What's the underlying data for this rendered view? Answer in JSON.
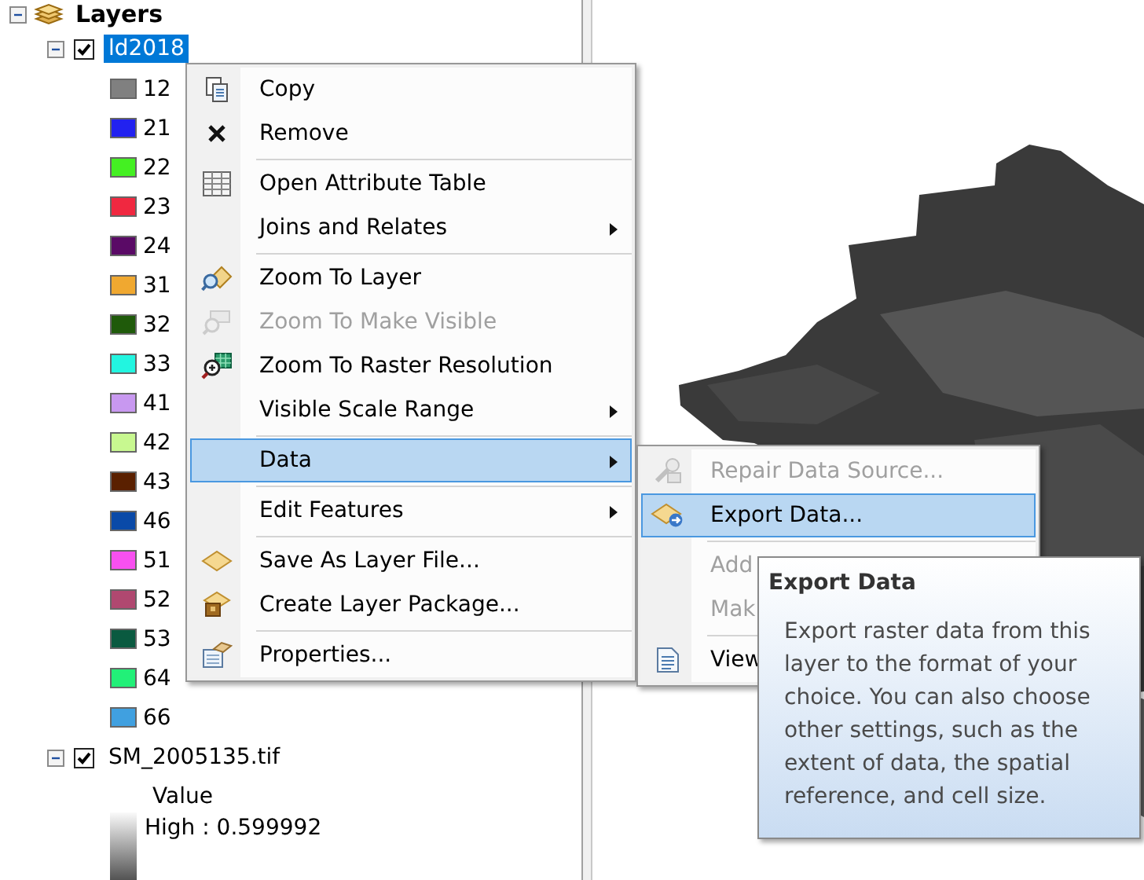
{
  "toc": {
    "title": "Layers",
    "expanded": true,
    "layers": [
      {
        "name": "ld2018",
        "expanded": true,
        "checked": true,
        "selected": true,
        "legend": [
          {
            "label": "12",
            "color": "#808080"
          },
          {
            "label": "21",
            "color": "#2222f0"
          },
          {
            "label": "22",
            "color": "#44f022"
          },
          {
            "label": "23",
            "color": "#f02840"
          },
          {
            "label": "24",
            "color": "#5a0a66"
          },
          {
            "label": "31",
            "color": "#f0a830"
          },
          {
            "label": "32",
            "color": "#1f5a0a"
          },
          {
            "label": "33",
            "color": "#22f5e0"
          },
          {
            "label": "41",
            "color": "#c898f0"
          },
          {
            "label": "42",
            "color": "#c8f890"
          },
          {
            "label": "43",
            "color": "#5a2000"
          },
          {
            "label": "46",
            "color": "#0a4aa8"
          },
          {
            "label": "51",
            "color": "#f850f0"
          },
          {
            "label": "52",
            "color": "#b04870"
          },
          {
            "label": "53",
            "color": "#0a5a40"
          },
          {
            "label": "64",
            "color": "#22f078"
          },
          {
            "label": "66",
            "color": "#40a0e0"
          }
        ]
      },
      {
        "name": "SM_2005135.tif",
        "expanded": true,
        "checked": true,
        "selected": false,
        "field": "Value",
        "high": "High : 0.599992"
      }
    ]
  },
  "context_menu": {
    "items": [
      {
        "kind": "item",
        "label": "Copy",
        "disabled": false,
        "selected": false,
        "submenu": false
      },
      {
        "kind": "item",
        "label": "Remove",
        "disabled": false,
        "selected": false,
        "submenu": false
      },
      {
        "kind": "separator"
      },
      {
        "kind": "item",
        "label": "Open Attribute Table",
        "disabled": false,
        "selected": false,
        "submenu": false
      },
      {
        "kind": "item",
        "label": "Joins and Relates",
        "disabled": false,
        "selected": false,
        "submenu": true
      },
      {
        "kind": "separator"
      },
      {
        "kind": "item",
        "label": "Zoom To Layer",
        "disabled": false,
        "selected": false,
        "submenu": false
      },
      {
        "kind": "item",
        "label": "Zoom To Make Visible",
        "disabled": true,
        "selected": false,
        "submenu": false
      },
      {
        "kind": "item",
        "label": "Zoom To Raster Resolution",
        "disabled": false,
        "selected": false,
        "submenu": false
      },
      {
        "kind": "item",
        "label": "Visible Scale Range",
        "disabled": false,
        "selected": false,
        "submenu": true
      },
      {
        "kind": "separator"
      },
      {
        "kind": "item",
        "label": "Data",
        "disabled": false,
        "selected": true,
        "submenu": true
      },
      {
        "kind": "separator"
      },
      {
        "kind": "item",
        "label": "Edit Features",
        "disabled": false,
        "selected": false,
        "submenu": true
      },
      {
        "kind": "separator"
      },
      {
        "kind": "item",
        "label": "Save As Layer File...",
        "disabled": false,
        "selected": false,
        "submenu": false
      },
      {
        "kind": "item",
        "label": "Create Layer Package...",
        "disabled": false,
        "selected": false,
        "submenu": false
      },
      {
        "kind": "separator"
      },
      {
        "kind": "item",
        "label": "Properties...",
        "disabled": false,
        "selected": false,
        "submenu": false
      }
    ]
  },
  "submenu": {
    "items": [
      {
        "kind": "item",
        "label": "Repair Data Source...",
        "disabled": true,
        "selected": false,
        "submenu": false
      },
      {
        "kind": "item",
        "label": "Export Data...",
        "disabled": false,
        "selected": true,
        "submenu": false
      },
      {
        "kind": "separator"
      },
      {
        "kind": "item",
        "label": "Add",
        "disabled": true,
        "selected": false,
        "submenu": false
      },
      {
        "kind": "item",
        "label": "Mak",
        "disabled": true,
        "selected": false,
        "submenu": false
      },
      {
        "kind": "separator"
      },
      {
        "kind": "item",
        "label": "View",
        "disabled": false,
        "selected": false,
        "submenu": false
      }
    ]
  },
  "tooltip": {
    "title": "Export Data",
    "text": "Export raster data from this layer to the format of your choice. You can also choose other settings, such as the extent of data, the spatial reference, and cell size."
  }
}
